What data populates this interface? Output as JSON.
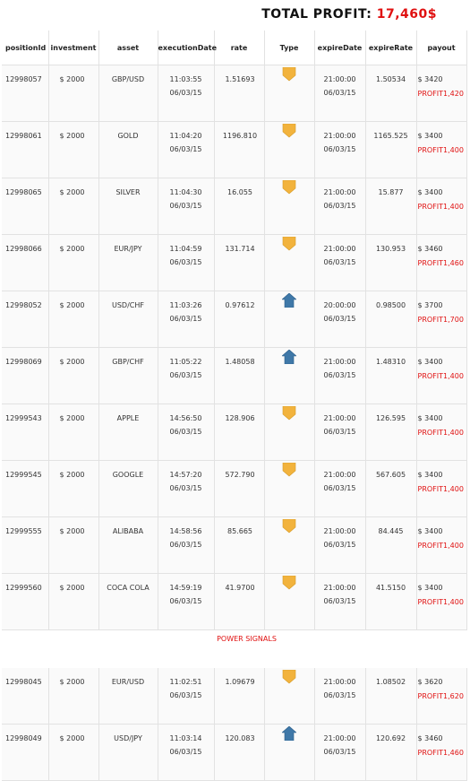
{
  "header": {
    "total_label": "TOTAL PROFIT:",
    "total_value": "17,460$"
  },
  "columns": [
    "positionId",
    "investment",
    "asset",
    "executionDate",
    "rate",
    "Type",
    "expireDate",
    "expireRate",
    "payout"
  ],
  "rows": [
    {
      "positionId": "12998057",
      "investment": "$ 2000",
      "asset": "GBP/USD",
      "exec_time": "11:03:55",
      "exec_date": "06/03/15",
      "rate": "1.51693",
      "type": "down",
      "expire_time": "21:00:00",
      "expire_date": "06/03/15",
      "expireRate": "1.50534",
      "payout": "$ 3420",
      "profit": "PROFIT1,420"
    },
    {
      "positionId": "12998061",
      "investment": "$ 2000",
      "asset": "GOLD",
      "exec_time": "11:04:20",
      "exec_date": "06/03/15",
      "rate": "1196.810",
      "type": "down",
      "expire_time": "21:00:00",
      "expire_date": "06/03/15",
      "expireRate": "1165.525",
      "payout": "$ 3400",
      "profit": "PROFIT1,400"
    },
    {
      "positionId": "12998065",
      "investment": "$ 2000",
      "asset": "SILVER",
      "exec_time": "11:04:30",
      "exec_date": "06/03/15",
      "rate": "16.055",
      "type": "down",
      "expire_time": "21:00:00",
      "expire_date": "06/03/15",
      "expireRate": "15.877",
      "payout": "$ 3400",
      "profit": "PROFIT1,400"
    },
    {
      "positionId": "12998066",
      "investment": "$ 2000",
      "asset": "EUR/JPY",
      "exec_time": "11:04:59",
      "exec_date": "06/03/15",
      "rate": "131.714",
      "type": "down",
      "expire_time": "21:00:00",
      "expire_date": "06/03/15",
      "expireRate": "130.953",
      "payout": "$ 3460",
      "profit": "PROFIT1,460"
    },
    {
      "positionId": "12998052",
      "investment": "$ 2000",
      "asset": "USD/CHF",
      "exec_time": "11:03:26",
      "exec_date": "06/03/15",
      "rate": "0.97612",
      "type": "up",
      "expire_time": "20:00:00",
      "expire_date": "06/03/15",
      "expireRate": "0.98500",
      "payout": "$ 3700",
      "profit": "PROFIT1,700"
    },
    {
      "positionId": "12998069",
      "investment": "$ 2000",
      "asset": "GBP/CHF",
      "exec_time": "11:05:22",
      "exec_date": "06/03/15",
      "rate": "1.48058",
      "type": "up",
      "expire_time": "21:00:00",
      "expire_date": "06/03/15",
      "expireRate": "1.48310",
      "payout": "$ 3400",
      "profit": "PROFIT1,400"
    },
    {
      "positionId": "12999543",
      "investment": "$ 2000",
      "asset": "APPLE",
      "exec_time": "14:56:50",
      "exec_date": "06/03/15",
      "rate": "128.906",
      "type": "down",
      "expire_time": "21:00:00",
      "expire_date": "06/03/15",
      "expireRate": "126.595",
      "payout": "$ 3400",
      "profit": "PROFIT1,400"
    },
    {
      "positionId": "12999545",
      "investment": "$ 2000",
      "asset": "GOOGLE",
      "exec_time": "14:57:20",
      "exec_date": "06/03/15",
      "rate": "572.790",
      "type": "down",
      "expire_time": "21:00:00",
      "expire_date": "06/03/15",
      "expireRate": "567.605",
      "payout": "$ 3400",
      "profit": "PROFIT1,400"
    },
    {
      "positionId": "12999555",
      "investment": "$ 2000",
      "asset": "ALIBABA",
      "exec_time": "14:58:56",
      "exec_date": "06/03/15",
      "rate": "85.665",
      "type": "down",
      "expire_time": "21:00:00",
      "expire_date": "06/03/15",
      "expireRate": "84.445",
      "payout": "$ 3400",
      "profit": "PROFIT1,400"
    },
    {
      "positionId": "12999560",
      "investment": "$ 2000",
      "asset": "COCA COLA",
      "exec_time": "14:59:19",
      "exec_date": "06/03/15",
      "rate": "41.9700",
      "type": "down",
      "expire_time": "21:00:00",
      "expire_date": "06/03/15",
      "expireRate": "41.5150",
      "payout": "$ 3400",
      "profit": "PROFIT1,400"
    }
  ],
  "signals_label": "POWER SIGNALS",
  "signal_rows": [
    {
      "positionId": "12998045",
      "investment": "$ 2000",
      "asset": "EUR/USD",
      "exec_time": "11:02:51",
      "exec_date": "06/03/15",
      "rate": "1.09679",
      "type": "down",
      "expire_time": "21:00:00",
      "expire_date": "06/03/15",
      "expireRate": "1.08502",
      "payout": "$ 3620",
      "profit": "PROFIT1,620"
    },
    {
      "positionId": "12998049",
      "investment": "$ 2000",
      "asset": "USD/JPY",
      "exec_time": "11:03:14",
      "exec_date": "06/03/15",
      "rate": "120.083",
      "type": "up",
      "expire_time": "21:00:00",
      "expire_date": "06/03/15",
      "expireRate": "120.692",
      "payout": "$ 3460",
      "profit": "PROFIT1,460"
    }
  ],
  "colors": {
    "profit": "#e01010",
    "down_arrow": "#f2b33d",
    "up_arrow": "#3f78a8"
  },
  "icons": {
    "down": "down-arrow-icon",
    "up": "up-arrow-icon"
  }
}
